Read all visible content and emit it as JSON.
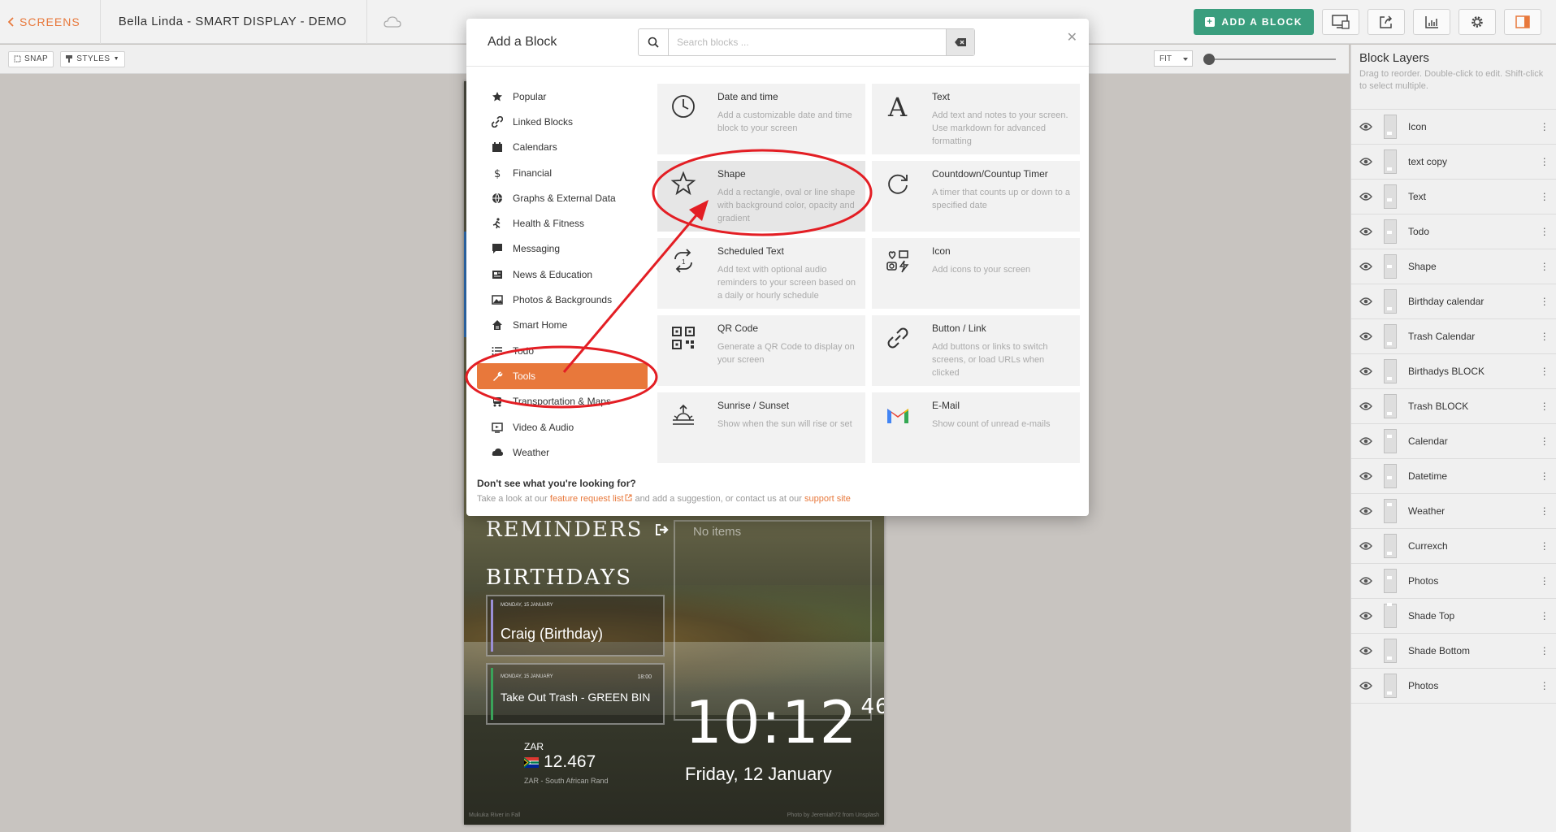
{
  "topbar": {
    "screens_label": "SCREENS",
    "title": "Bella Linda - SMART DISPLAY - DEMO",
    "add_block_label": "ADD A BLOCK"
  },
  "subbar": {
    "snap_label": "SNAP",
    "styles_label": "STYLES",
    "fit_label": "FIT"
  },
  "layers": {
    "title": "Block Layers",
    "hint": "Drag to reorder. Double-click to edit. Shift-click to select multiple.",
    "items": [
      "Icon",
      "text copy",
      "Text",
      "Todo",
      "Shape",
      "Birthday calendar",
      "Trash Calendar",
      "Birthadys BLOCK",
      "Trash BLOCK",
      "Calendar",
      "Datetime",
      "Weather",
      "Currexch",
      "Photos",
      "Shade Top",
      "Shade Bottom",
      "Photos"
    ]
  },
  "modal": {
    "title": "Add a Block",
    "search_placeholder": "Search blocks ...",
    "categories": [
      "Popular",
      "Linked Blocks",
      "Calendars",
      "Financial",
      "Graphs & External Data",
      "Health & Fitness",
      "Messaging",
      "News & Education",
      "Photos & Backgrounds",
      "Smart Home",
      "Todo",
      "Tools",
      "Transportation & Maps",
      "Video & Audio",
      "Weather"
    ],
    "active_category": "Tools",
    "blocks": [
      {
        "title": "Date and time",
        "desc": "Add a customizable date and time block to your screen",
        "icon": "clock-icon"
      },
      {
        "title": "Text",
        "desc": "Add text and notes to your screen. Use markdown for advanced formatting",
        "icon": "text-icon"
      },
      {
        "title": "Shape",
        "desc": "Add a rectangle, oval or line shape with background color, opacity and gradient",
        "icon": "star-icon"
      },
      {
        "title": "Countdown/Countup Timer",
        "desc": "A timer that counts up or down to a specified date",
        "icon": "refresh-icon"
      },
      {
        "title": "Scheduled Text",
        "desc": "Add text with optional audio reminders to your screen based on a daily or hourly schedule",
        "icon": "repeat-icon"
      },
      {
        "title": "Icon",
        "desc": "Add icons to your screen",
        "icon": "icons-icon"
      },
      {
        "title": "QR Code",
        "desc": "Generate a QR Code to display on your screen",
        "icon": "qr-icon"
      },
      {
        "title": "Button / Link",
        "desc": "Add buttons or links to switch screens, or load URLs when clicked",
        "icon": "link-icon"
      },
      {
        "title": "Sunrise / Sunset",
        "desc": "Show when the sun will rise or set",
        "icon": "sunrise-icon"
      },
      {
        "title": "E-Mail",
        "desc": "Show count of unread e-mails",
        "icon": "gmail-icon"
      }
    ],
    "footer_question": "Don't see what you're looking for?",
    "footer_pre": "Take a look at our ",
    "footer_link1": "feature request list",
    "footer_mid": " and add a suggestion, or contact us at our ",
    "footer_link2": "support site"
  },
  "preview": {
    "reminders": "REMINDERS",
    "birthdays": "BIRTHDAYS",
    "birthday_date": "MONDAY, 15 JANUARY",
    "birthday_event": "Craig (Birthday)",
    "trash_date": "MONDAY, 15 JANUARY",
    "trash_time": "18:00",
    "trash_event": "Take Out Trash - GREEN BIN",
    "no_items": "No items",
    "time": "10:12",
    "seconds": "46",
    "date": "Friday, 12 January",
    "currency_code": "ZAR",
    "currency_value": "12.467",
    "currency_name": "ZAR - South African Rand",
    "credit_left": "Mukuka River in Fall",
    "credit_right": "Photo by Jeremiah72 from Unsplash"
  },
  "colors": {
    "accent": "#e8783b",
    "brand_green": "#3a9e7e",
    "annotation": "#e31e24"
  }
}
